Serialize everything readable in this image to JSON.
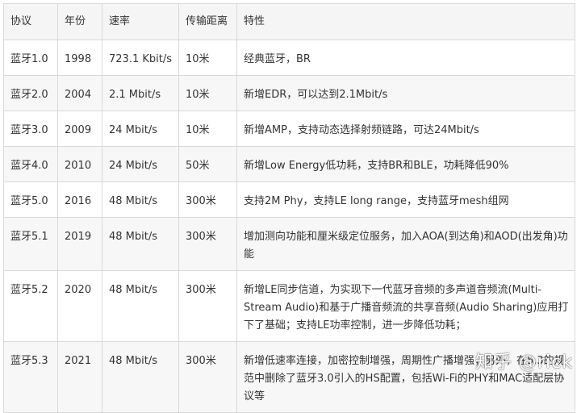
{
  "table": {
    "headers": [
      "协议",
      "年份",
      "速率",
      "传输距离",
      "特性"
    ],
    "rows": [
      [
        "蓝牙1.0",
        "1998",
        "723.1 Kbit/s",
        "10米",
        "经典蓝牙，BR"
      ],
      [
        "蓝牙2.0",
        "2004",
        "2.1 Mbit/s",
        "10米",
        "新增EDR，可以达到2.1Mbit/s"
      ],
      [
        "蓝牙3.0",
        "2009",
        "24 Mbit/s",
        "10米",
        "新增AMP，支持动态选择射频链路，可达24Mbit/s"
      ],
      [
        "蓝牙4.0",
        "2010",
        "24 Mbit/s",
        "50米",
        "新增Low Energy低功耗，支持BR和BLE，功耗降低90%"
      ],
      [
        "蓝牙5.0",
        "2016",
        "48 Mbit/s",
        "300米",
        "支持2M Phy，支持LE long range，支持蓝牙mesh组网"
      ],
      [
        "蓝牙5.1",
        "2019",
        "48 Mbit/s",
        "300米",
        "增加测向功能和厘米级定位服务，加入AOA(到达角)和AOD(出发角)功能"
      ],
      [
        "蓝牙5.2",
        "2020",
        "48 Mbit/s",
        "300米",
        "新增LE同步信道，为实现下一代蓝牙音频的多声道音频流(Multi-Stream Audio)和基于广播音频流的共享音频(Audio Sharing)应用打下了基础；支持LE功率控制，进一步降低功耗；"
      ],
      [
        "蓝牙5.3",
        "2021",
        "48 Mbit/s",
        "300米",
        "新增低速率连接，加密控制增强，周期性广播增强；另外，在5.3的规范中删除了蓝牙3.0引入的HS配置，包括Wi-Fi的PHY和MAC适配层协议等"
      ]
    ]
  },
  "watermark": "知乎 @rick"
}
